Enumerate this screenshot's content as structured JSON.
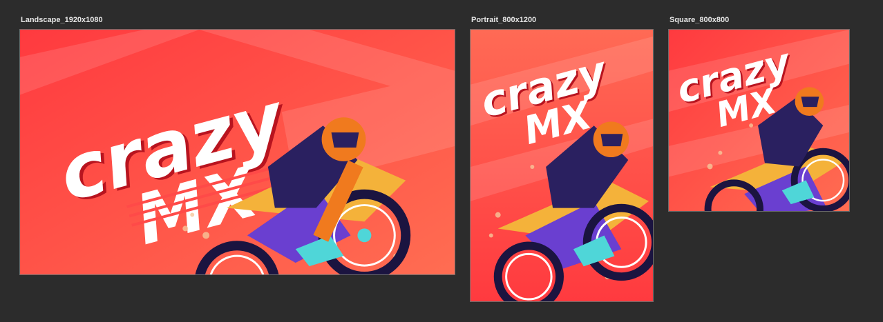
{
  "canvas": {
    "background": "#2c2c2c"
  },
  "frames": [
    {
      "label": "Landscape_1920x1080"
    },
    {
      "label": "Portrait_800x1200"
    },
    {
      "label": "Square_800x800"
    }
  ],
  "artwork": {
    "title_line1": "crazy",
    "title_line2": "MX",
    "colors": {
      "bg_start": "#ff3b3f",
      "bg_end": "#ff6a55",
      "text": "#ffffff",
      "text_shadow": "#b8141f",
      "bike_purple": "#6a3fd0",
      "rider_navy": "#2a2060",
      "helmet": "#f07a1e",
      "accent_cyan": "#4fd6d8",
      "accent_yellow": "#f4b23a",
      "tire": "#1b1440"
    }
  }
}
